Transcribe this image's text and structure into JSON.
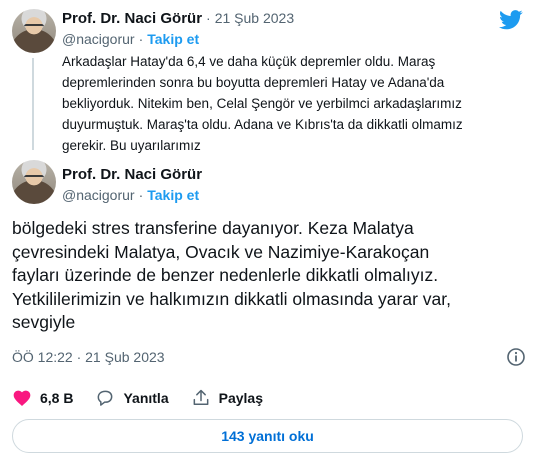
{
  "quoted_tweet": {
    "author_name": "Prof. Dr. Naci Görür",
    "separator": "·",
    "date": "21 Şub 2023",
    "handle": "@nacigorur",
    "follow_separator": "·",
    "follow_label": "Takip et",
    "text_lines": [
      "Arkadaşlar Hatay'da 6,4 ve daha küçük depremler oldu. Maraş",
      "depremlerinden sonra bu boyutta depremleri Hatay ve Adana'da",
      "bekliyorduk. Nitekim ben, Celal Şengör ve yerbilmci arkadaşlarımız",
      "duyurmuştuk. Maraş'ta oldu. Adana ve Kıbrıs'ta da dikkatli olmamız",
      "gerekir. Bu uyarılarımız"
    ]
  },
  "main_tweet": {
    "author_name": "Prof. Dr. Naci Görür",
    "handle": "@nacigorur",
    "follow_separator": "·",
    "follow_label": "Takip et",
    "text_lines": [
      "bölgedeki stres transferine dayanıyor. Keza Malatya",
      "çevresindeki Malatya, Ovacık ve Nazimiye-Karakoçan",
      "fayları üzerinde de benzer nedenlerle dikkatli olmalıyız.",
      "Yetkililerimizin ve halkımızın dikkatli olmasında yarar var,",
      "sevgiyle"
    ],
    "timestamp": "ÖÖ 12:22 · 21 Şub 2023"
  },
  "actions": {
    "like_count": "6,8 B",
    "reply_label": "Yanıtla",
    "share_label": "Paylaş"
  },
  "replies_button_label": "143 yanıtı oku",
  "colors": {
    "accent": "#1d9bf0",
    "like": "#f91880",
    "secondary_text": "#536471"
  },
  "icons": [
    "twitter-logo-icon",
    "heart-icon",
    "reply-icon",
    "share-icon",
    "info-icon"
  ]
}
